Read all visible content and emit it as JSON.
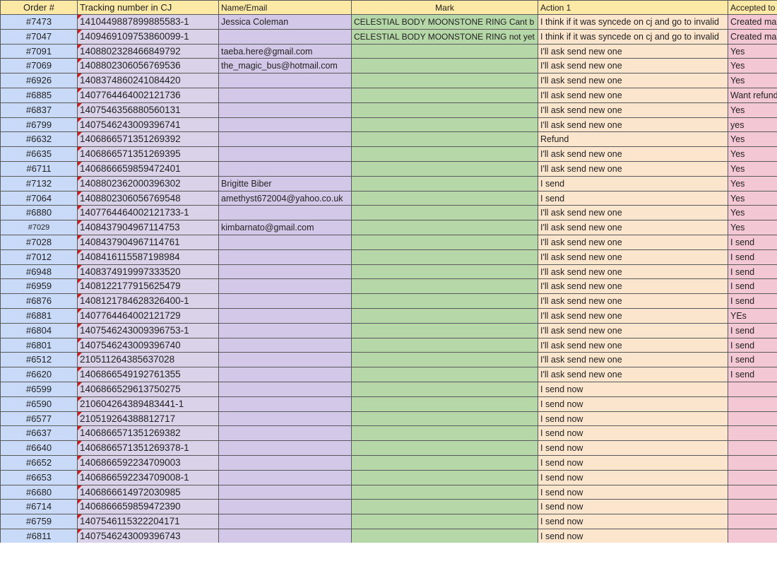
{
  "columns": {
    "order": "Order #",
    "tracking": "Tracking  number in CJ",
    "name": "Name/Email",
    "mark": "Mark",
    "action": "Action 1",
    "accepted": "Accepted to"
  },
  "rows": [
    {
      "order": "#7473",
      "tracking": "1410449887899885583-1",
      "name": "Jessica Coleman",
      "mark": "CELESTIAL BODY MOONSTONE RING  Cant b",
      "action": "I think if it was syncede on cj and go to  invalid",
      "accepted": "Created ma"
    },
    {
      "order": "#7047",
      "tracking": "1409469109753860099-1",
      "name": "",
      "mark": "CELESTIAL BODY MOONSTONE RING  not yet",
      "action": "I think if it was syncede on cj and go to  invalid",
      "accepted": "Created ma"
    },
    {
      "order": "#7091",
      "tracking": "1408802328466849792",
      "name": "taeba.here@gmail.com",
      "mark": "",
      "action": "I'll ask send new one",
      "accepted": "Yes"
    },
    {
      "order": "#7069",
      "tracking": "1408802306056769536",
      "name": "the_magic_bus@hotmail.com",
      "mark": "",
      "action": "I'll ask send new one",
      "accepted": "Yes"
    },
    {
      "order": "#6926",
      "tracking": "1408374860241084420",
      "name": "",
      "mark": "",
      "action": "I'll ask send new one",
      "accepted": "Yes"
    },
    {
      "order": "#6885",
      "tracking": "1407764464002121736",
      "name": "",
      "mark": "",
      "action": "I'll ask send new one",
      "accepted": "Want refund"
    },
    {
      "order": "#6837",
      "tracking": "1407546356880560131",
      "name": "",
      "mark": "",
      "action": "I'll ask send new one",
      "accepted": "Yes"
    },
    {
      "order": "#6799",
      "tracking": "1407546243009396741",
      "name": "",
      "mark": "",
      "action": "I'll ask send new one",
      "accepted": "yes"
    },
    {
      "order": "#6632",
      "tracking": "1406866571351269392",
      "name": "",
      "mark": "",
      "action": "Refund",
      "accepted": "Yes"
    },
    {
      "order": "#6635",
      "tracking": "1406866571351269395",
      "name": "",
      "mark": "",
      "action": "I'll ask send new one",
      "accepted": "Yes"
    },
    {
      "order": "#6711",
      "tracking": "1406866659859472401",
      "name": "",
      "mark": "",
      "action": "I'll ask send new one",
      "accepted": "Yes"
    },
    {
      "order": "#7132",
      "tracking": "1408802362000396302",
      "name": "Brigitte Biber",
      "mark": "",
      "action": "I send",
      "accepted": "Yes"
    },
    {
      "order": "#7064",
      "tracking": "1408802306056769548",
      "name": "amethyst672004@yahoo.co.uk",
      "mark": "",
      "action": "I send",
      "accepted": "Yes"
    },
    {
      "order": "#6880",
      "tracking": "1407764464002121733-1",
      "name": "",
      "mark": "",
      "action": "I'll ask send new one",
      "accepted": "Yes"
    },
    {
      "order": "#7029",
      "tracking": "1408437904967114753",
      "name": "kimbarnato@gmail.com",
      "mark": "",
      "action": "I'll ask send new one",
      "accepted": "Yes"
    },
    {
      "order": "#7028",
      "tracking": "1408437904967114761",
      "name": "",
      "mark": "",
      "action": "I'll ask send new one",
      "accepted": "I send"
    },
    {
      "order": "#7012",
      "tracking": "1408416115587198984",
      "name": "",
      "mark": "",
      "action": "I'll ask send new one",
      "accepted": "I send"
    },
    {
      "order": "#6948",
      "tracking": "1408374919997333520",
      "name": "",
      "mark": "",
      "action": "I'll ask send new one",
      "accepted": "I send"
    },
    {
      "order": "#6959",
      "tracking": "1408122177915625479",
      "name": "",
      "mark": "",
      "action": "I'll ask send new one",
      "accepted": "I send"
    },
    {
      "order": "#6876",
      "tracking": "1408121784628326400-1",
      "name": "",
      "mark": "",
      "action": "I'll ask send new one",
      "accepted": "I send"
    },
    {
      "order": "#6881",
      "tracking": "1407764464002121729",
      "name": "",
      "mark": "",
      "action": "I'll ask send new one",
      "accepted": "YEs"
    },
    {
      "order": "#6804",
      "tracking": "1407546243009396753-1",
      "name": "",
      "mark": "",
      "action": "I'll ask send new one",
      "accepted": "I send"
    },
    {
      "order": "#6801",
      "tracking": "1407546243009396740",
      "name": "",
      "mark": "",
      "action": "I'll ask send new one",
      "accepted": "I send"
    },
    {
      "order": "#6512",
      "tracking": "210511264385637028",
      "name": "",
      "mark": "",
      "action": "I'll ask send new one",
      "accepted": "I send"
    },
    {
      "order": "#6620",
      "tracking": "1406866549192761355",
      "name": "",
      "mark": "",
      "action": "I'll ask send new one",
      "accepted": "I send"
    },
    {
      "order": "#6599",
      "tracking": "1406866529613750275",
      "name": "",
      "mark": "",
      "action": "I send now",
      "accepted": ""
    },
    {
      "order": "#6590",
      "tracking": "210604264389483441-1",
      "name": "",
      "mark": "",
      "action": "I send now",
      "accepted": ""
    },
    {
      "order": "#6577",
      "tracking": "210519264388812717",
      "name": "",
      "mark": "",
      "action": "I send now",
      "accepted": ""
    },
    {
      "order": "#6637",
      "tracking": "1406866571351269382",
      "name": "",
      "mark": "",
      "action": "I send now",
      "accepted": ""
    },
    {
      "order": "#6640",
      "tracking": "1406866571351269378-1",
      "name": "",
      "mark": "",
      "action": "I send now",
      "accepted": ""
    },
    {
      "order": "#6652",
      "tracking": "1406866592234709003",
      "name": "",
      "mark": "",
      "action": "I send now",
      "accepted": ""
    },
    {
      "order": "#6653",
      "tracking": "1406866592234709008-1",
      "name": "",
      "mark": "",
      "action": "I send now",
      "accepted": ""
    },
    {
      "order": "#6680",
      "tracking": "1406866614972030985",
      "name": "",
      "mark": "",
      "action": "I send now",
      "accepted": ""
    },
    {
      "order": "#6714",
      "tracking": "1406866659859472390",
      "name": "",
      "mark": "",
      "action": "I send now",
      "accepted": ""
    },
    {
      "order": "#6759",
      "tracking": "1407546115322204171",
      "name": "",
      "mark": "",
      "action": "I send now",
      "accepted": ""
    },
    {
      "order": "#6811",
      "tracking": "1407546243009396743",
      "name": "",
      "mark": "",
      "action": "I send now",
      "accepted": ""
    }
  ]
}
